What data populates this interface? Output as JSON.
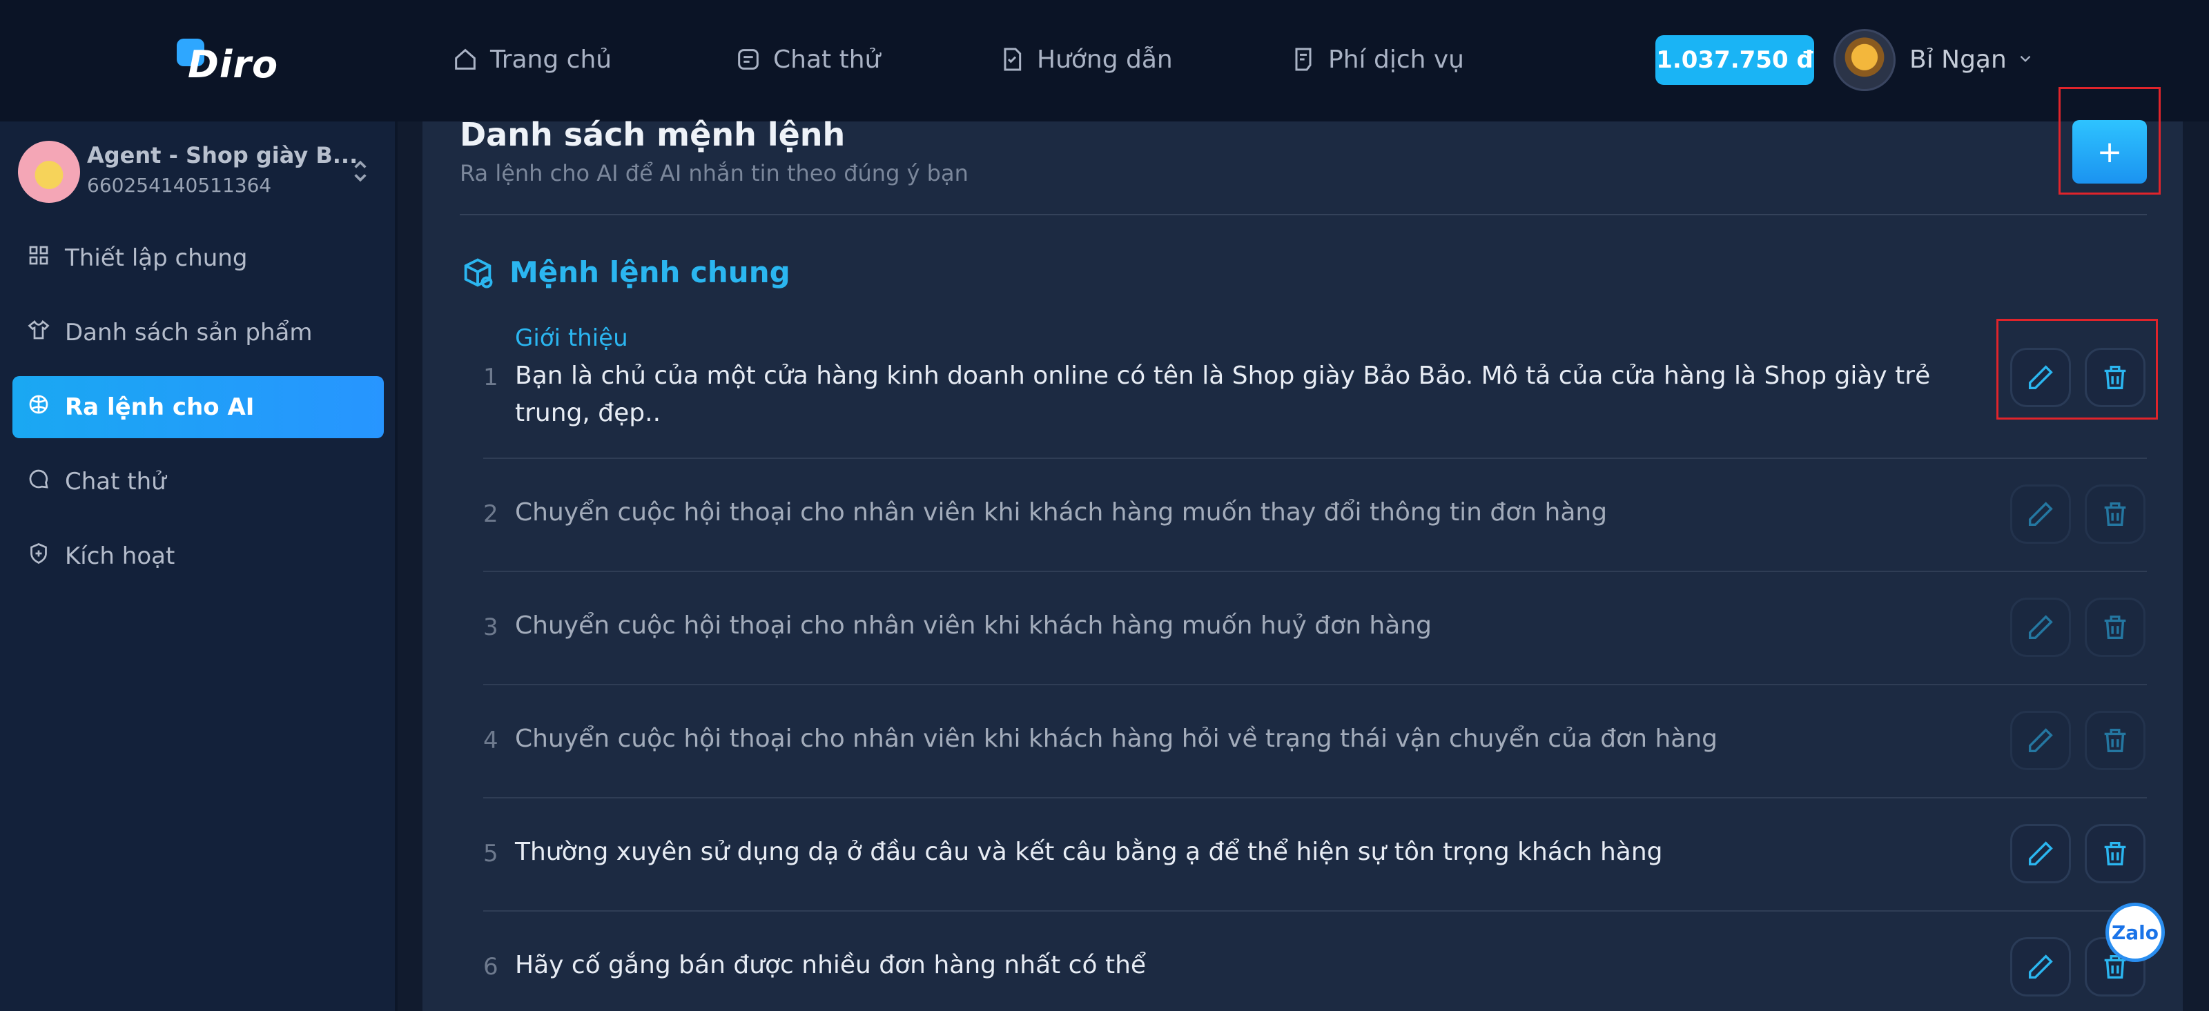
{
  "header": {
    "brand": "Diro",
    "nav": [
      {
        "label": "Trang chủ",
        "icon": "home-icon"
      },
      {
        "label": "Chat thử",
        "icon": "chat-icon"
      },
      {
        "label": "Hướng dẫn",
        "icon": "guide-icon"
      },
      {
        "label": "Phí dịch vụ",
        "icon": "fee-icon"
      }
    ],
    "balance": "1.037.750 đ",
    "user_name": "Bỉ Ngạn"
  },
  "sidebar": {
    "agent_name": "Agent - Shop giày B...",
    "agent_id": "660254140511364",
    "items": [
      {
        "label": "Thiết lập chung",
        "icon": "grid-icon",
        "active": false
      },
      {
        "label": "Danh sách sản phẩm",
        "icon": "shirt-icon",
        "active": false
      },
      {
        "label": "Ra lệnh cho AI",
        "icon": "ai-icon",
        "active": true
      },
      {
        "label": "Chat thử",
        "icon": "chat-icon",
        "active": false
      },
      {
        "label": "Kích hoạt",
        "icon": "shield-icon",
        "active": false
      }
    ]
  },
  "main": {
    "title": "Danh sách mệnh lệnh",
    "subtitle": "Ra lệnh cho AI để AI nhắn tin theo đúng ý bạn",
    "add_label": "+",
    "section_title": "Mệnh lệnh chung",
    "commands": [
      {
        "num": "1",
        "tag": "Giới thiệu",
        "text": "Bạn là chủ của một cửa hàng kinh doanh online có tên là Shop giày Bảo Bảo. Mô tả của cửa hàng là Shop giày trẻ trung, đẹp..",
        "enabled": true
      },
      {
        "num": "2",
        "text": "Chuyển cuộc hội thoại cho nhân viên khi khách hàng muốn thay đổi thông tin đơn hàng",
        "enabled": false
      },
      {
        "num": "3",
        "text": "Chuyển cuộc hội thoại cho nhân viên khi khách hàng muốn huỷ đơn hàng",
        "enabled": false
      },
      {
        "num": "4",
        "text": "Chuyển cuộc hội thoại cho nhân viên khi khách hàng hỏi về trạng thái vận chuyển của đơn hàng",
        "enabled": false
      },
      {
        "num": "5",
        "text": "Thường xuyên sử dụng dạ ở đầu câu và kết câu bằng ạ để thể hiện sự tôn trọng khách hàng",
        "enabled": true
      },
      {
        "num": "6",
        "text": "Hãy cố gắng bán được nhiều đơn hàng nhất có thể",
        "enabled": true
      }
    ]
  },
  "widget": {
    "zalo_label": "Zalo"
  },
  "colors": {
    "accent": "#2bb6f0",
    "highlight_box": "#e0242b"
  }
}
